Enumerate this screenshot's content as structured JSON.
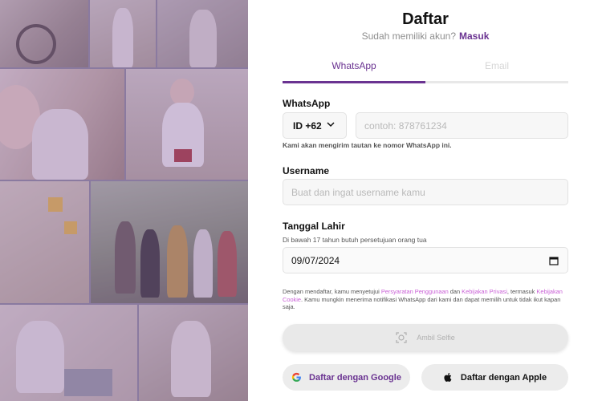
{
  "header": {
    "title": "Daftar",
    "subtitle": "Sudah memiliki akun?",
    "login_link": "Masuk"
  },
  "tabs": [
    {
      "label": "WhatsApp",
      "active": true
    },
    {
      "label": "Email",
      "active": false
    }
  ],
  "whatsapp": {
    "label": "WhatsApp",
    "country_code": "ID +62",
    "phone_placeholder": "contoh: 878761234",
    "hint": "Kami akan mengirim tautan ke nomor WhatsApp ini."
  },
  "username": {
    "label": "Username",
    "placeholder": "Buat dan ingat username kamu"
  },
  "birthdate": {
    "label": "Tanggal Lahir",
    "hint": "Di bawah 17 tahun butuh persetujuan orang tua",
    "value": "09/07/2024"
  },
  "terms": {
    "prefix": "Dengan mendaftar, kamu menyetujui",
    "tos": "Persyaratan Penggunaan",
    "and": "dan",
    "privacy": "Kebijakan Privasi",
    "including": ", termasuk",
    "cookie": "Kebijakan Cookie",
    "suffix": ". Kamu mungkin menerima notifikasi WhatsApp dari kami dan dapat memilih untuk tidak ikut kapan saja."
  },
  "buttons": {
    "selfie": "Ambil Selfie",
    "google": "Daftar dengan Google",
    "apple": "Daftar dengan Apple"
  },
  "colors": {
    "accent": "#6a3391",
    "link_pink": "#c95fd6",
    "overlay": "#7850a0"
  }
}
